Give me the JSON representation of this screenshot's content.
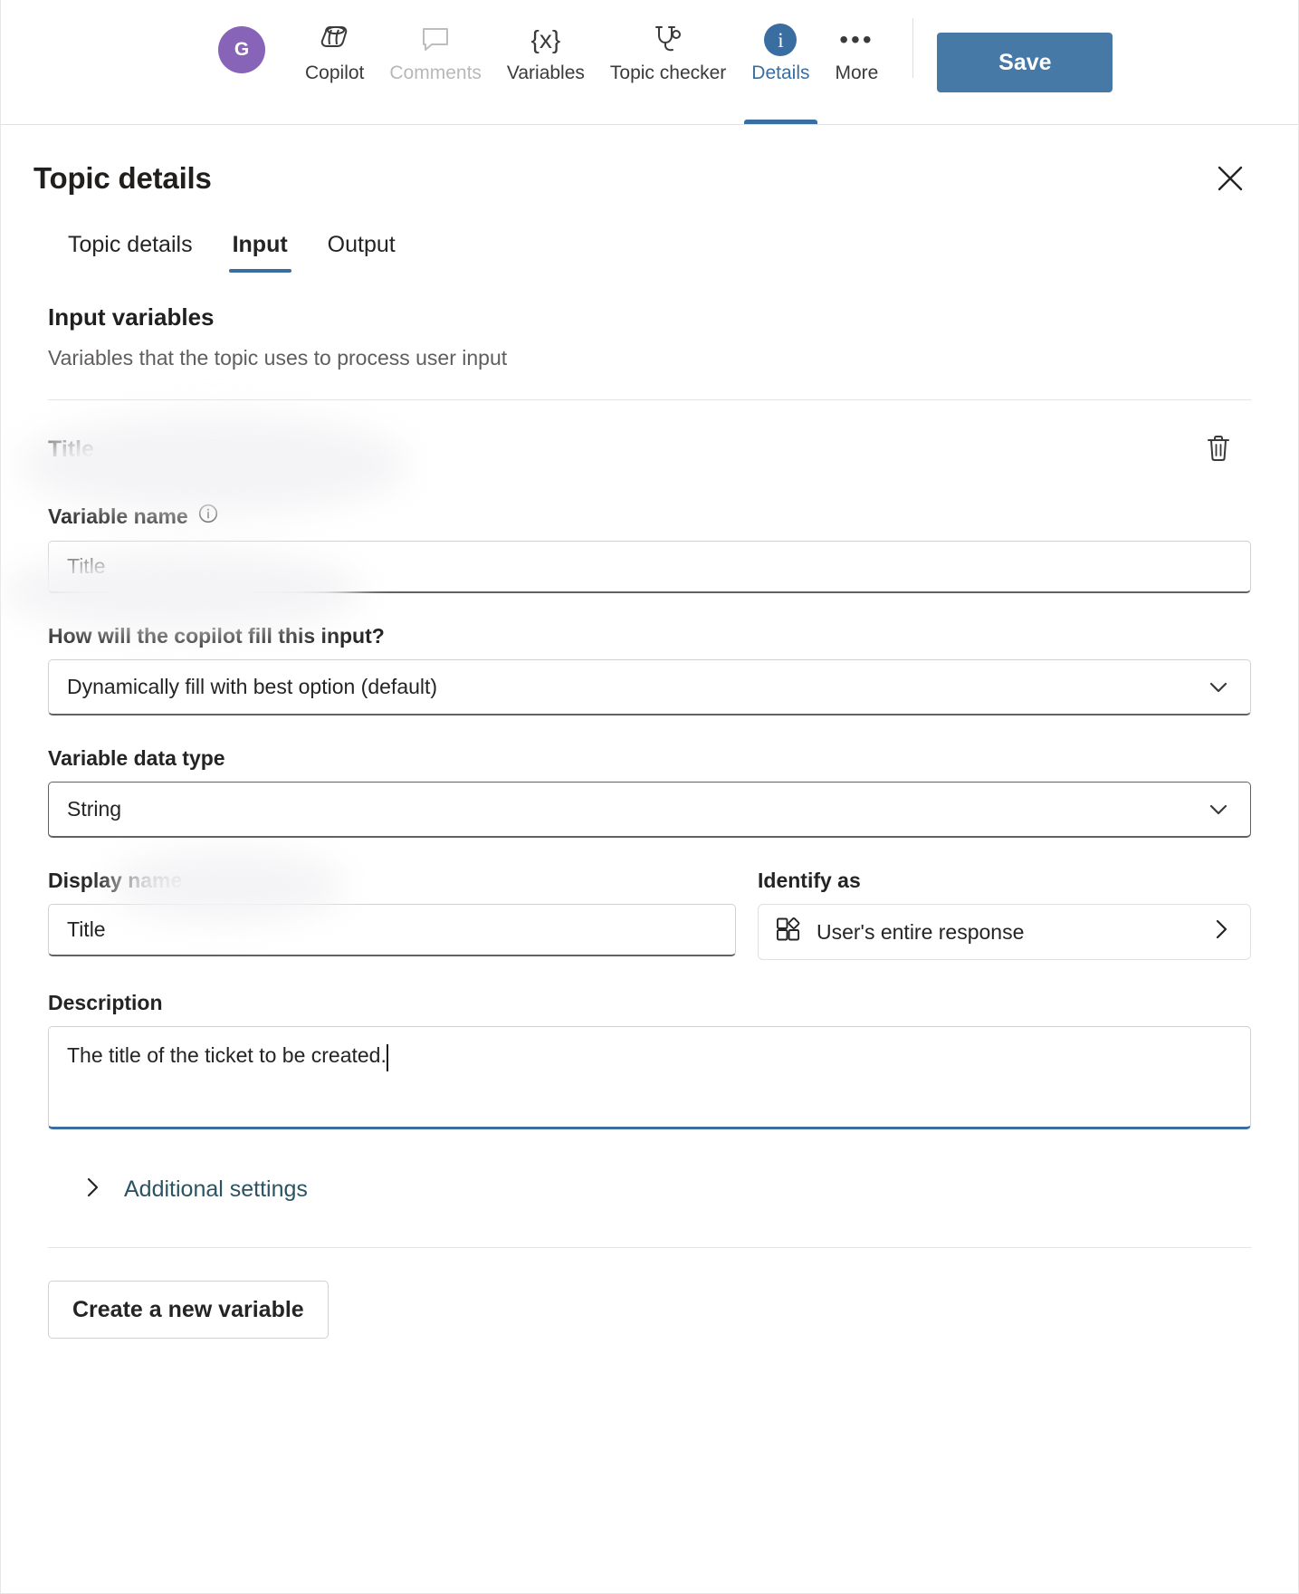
{
  "commandbar": {
    "avatar_initial": "G",
    "items": [
      {
        "label": "Copilot",
        "icon": "copilot-icon",
        "state": "normal"
      },
      {
        "label": "Comments",
        "icon": "comment-icon",
        "state": "disabled"
      },
      {
        "label": "Variables",
        "icon": "variables-braces-icon",
        "state": "normal"
      },
      {
        "label": "Topic checker",
        "icon": "stethoscope-icon",
        "state": "normal"
      },
      {
        "label": "Details",
        "icon": "info-circle-icon",
        "state": "active"
      },
      {
        "label": "More",
        "icon": "ellipsis-icon",
        "state": "normal"
      }
    ],
    "save_label": "Save",
    "accent_color": "#4779a7",
    "avatar_color": "#8764b8"
  },
  "panel": {
    "title": "Topic details",
    "close_label": "Close",
    "tabs": [
      {
        "label": "Topic details",
        "selected": false
      },
      {
        "label": "Input",
        "selected": true
      },
      {
        "label": "Output",
        "selected": false
      }
    ],
    "section": {
      "heading": "Input variables",
      "subheading": "Variables that the topic uses to process user input"
    },
    "variable": {
      "name": "Title",
      "delete_tooltip": "Delete",
      "fields": {
        "variable_name_label": "Variable name",
        "variable_name_value": "Title",
        "fill_label": "How will the copilot fill this input?",
        "fill_value": "Dynamically fill with best option (default)",
        "data_type_label": "Variable data type",
        "data_type_value": "String",
        "display_name_label": "Display name",
        "display_name_value": "Title",
        "identify_as_label": "Identify as",
        "identify_as_value": "User's entire response",
        "description_label": "Description",
        "description_value": "The title of the ticket to be created."
      },
      "additional_settings_label": "Additional settings"
    },
    "create_variable_label": "Create a new variable"
  }
}
